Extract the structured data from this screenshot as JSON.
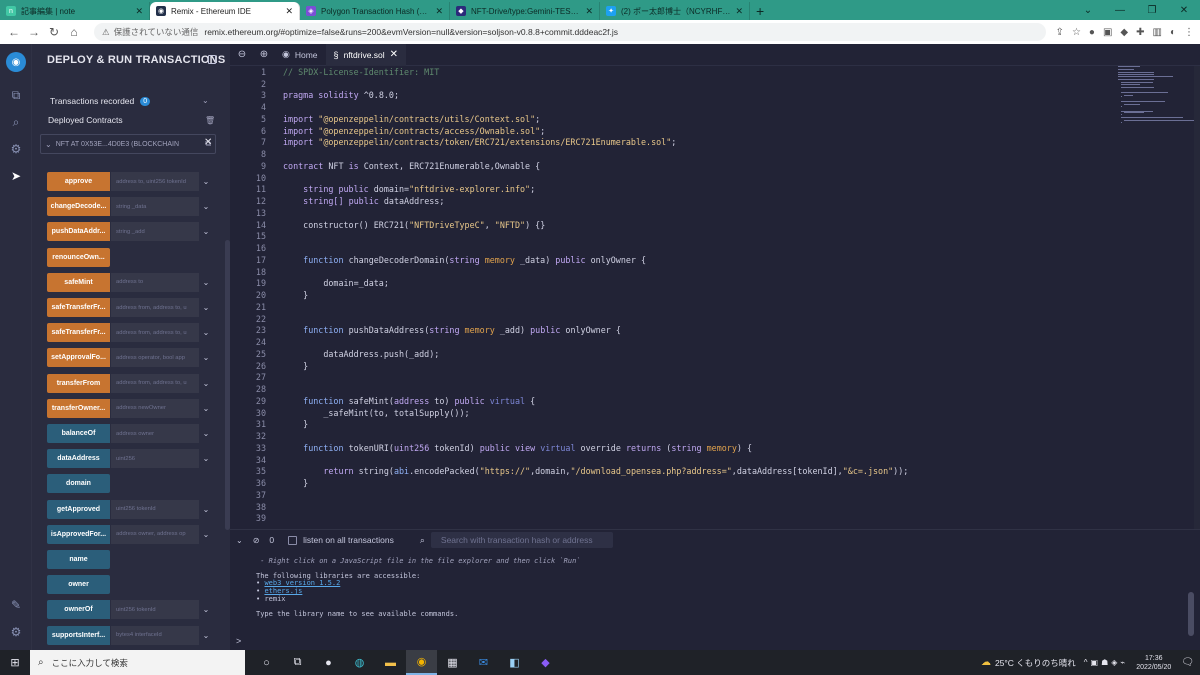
{
  "browser": {
    "tabs": [
      {
        "label": "記事編集 | note",
        "fav": "n",
        "color": "#42c8a5",
        "active": false
      },
      {
        "label": "Remix - Ethereum IDE",
        "fav": "◉",
        "color": "#23304a",
        "active": true
      },
      {
        "label": "Polygon Transaction Hash (Txhas",
        "fav": "◈",
        "color": "#7b4fd6",
        "active": false
      },
      {
        "label": "NFT-Drive/type:Gemini-TEST_NE",
        "fav": "◆",
        "color": "#2b2a7a",
        "active": false
      },
      {
        "label": "(2) ポー太郎博士（NCYRHFYAW7）",
        "fav": "✦",
        "color": "#1da1f2",
        "active": false
      }
    ],
    "new_tab": "+",
    "security_label": "保護されていない通信",
    "url": "remix.ethereum.org/#optimize=false&runs=200&evmVersion=null&version=soljson-v0.8.8+commit.dddeac2f.js"
  },
  "sidebar": {
    "title": "DEPLOY & RUN TRANSACTIONS",
    "tx_recorded_label": "Transactions recorded",
    "tx_recorded_count": "0",
    "deployed_label": "Deployed Contracts",
    "instance_label": "NFT AT 0X53E...4D0E3 (BLOCKCHAIN",
    "functions": [
      {
        "name": "approve",
        "params": "address to, uint256 tokenId",
        "color": "orange",
        "has_param": true
      },
      {
        "name": "changeDecode...",
        "params": "string _data",
        "color": "orange",
        "has_param": true
      },
      {
        "name": "pushDataAddr...",
        "params": "string _add",
        "color": "orange",
        "has_param": true
      },
      {
        "name": "renounceOwn...",
        "params": "",
        "color": "orange",
        "has_param": false
      },
      {
        "name": "safeMint",
        "params": "address to",
        "color": "orange",
        "has_param": true
      },
      {
        "name": "safeTransferFr...",
        "params": "address from, address to, u",
        "color": "orange",
        "has_param": true
      },
      {
        "name": "safeTransferFr...",
        "params": "address from, address to, u",
        "color": "orange",
        "has_param": true
      },
      {
        "name": "setApprovalFo...",
        "params": "address operator, bool app",
        "color": "orange",
        "has_param": true
      },
      {
        "name": "transferFrom",
        "params": "address from, address to, u",
        "color": "orange",
        "has_param": true
      },
      {
        "name": "transferOwner...",
        "params": "address newOwner",
        "color": "orange",
        "has_param": true
      },
      {
        "name": "balanceOf",
        "params": "address owner",
        "color": "blue",
        "has_param": true
      },
      {
        "name": "dataAddress",
        "params": "uint256",
        "color": "blue",
        "has_param": true
      },
      {
        "name": "domain",
        "params": "",
        "color": "blue",
        "has_param": false
      },
      {
        "name": "getApproved",
        "params": "uint256 tokenId",
        "color": "blue",
        "has_param": true
      },
      {
        "name": "isApprovedFor...",
        "params": "address owner, address op",
        "color": "blue",
        "has_param": true
      },
      {
        "name": "name",
        "params": "",
        "color": "blue",
        "has_param": false
      },
      {
        "name": "owner",
        "params": "",
        "color": "blue",
        "has_param": false
      },
      {
        "name": "ownerOf",
        "params": "uint256 tokenId",
        "color": "blue",
        "has_param": true
      },
      {
        "name": "supportsInterf...",
        "params": "bytes4 interfaceId",
        "color": "blue",
        "has_param": true
      }
    ]
  },
  "editor": {
    "tabs": [
      {
        "label": "Home",
        "icon": "◉",
        "active": false,
        "closable": false
      },
      {
        "label": "nftdrive.sol",
        "icon": "§",
        "active": true,
        "closable": true
      }
    ],
    "lines": [
      [
        [
          "// SPDX-License-Identifier: MIT",
          "#5f8a6e"
        ]
      ],
      [],
      [
        [
          "pragma ",
          "#c0a8f2"
        ],
        [
          "solidity ",
          "#c0a8f2"
        ],
        [
          "^0.8.0;",
          "#d0d1e3"
        ]
      ],
      [],
      [
        [
          "import ",
          "#c0a8f2"
        ],
        [
          "\"@openzeppelin/contracts/utils/Context.sol\"",
          "#e8c78a"
        ],
        [
          ";",
          "#d0d1e3"
        ]
      ],
      [
        [
          "import ",
          "#c0a8f2"
        ],
        [
          "\"@openzeppelin/contracts/access/Ownable.sol\"",
          "#e8c78a"
        ],
        [
          ";",
          "#d0d1e3"
        ]
      ],
      [
        [
          "import ",
          "#c0a8f2"
        ],
        [
          "\"@openzeppelin/contracts/token/ERC721/extensions/ERC721Enumerable.sol\"",
          "#e8c78a"
        ],
        [
          ";",
          "#d0d1e3"
        ]
      ],
      [],
      [
        [
          "contract ",
          "#c0a8f2"
        ],
        [
          "NFT ",
          "#d0d1e3"
        ],
        [
          "is ",
          "#c0a8f2"
        ],
        [
          "Context, ERC721Enumerable,Ownable {",
          "#d0d1e3"
        ]
      ],
      [],
      [
        [
          "    string ",
          "#c0a8f2"
        ],
        [
          "public ",
          "#c0a8f2"
        ],
        [
          "domain=",
          "#d0d1e3"
        ],
        [
          "\"nftdrive-explorer.info\"",
          "#e8c78a"
        ],
        [
          ";",
          "#d0d1e3"
        ]
      ],
      [
        [
          "    string[] ",
          "#c0a8f2"
        ],
        [
          "public ",
          "#c0a8f2"
        ],
        [
          "dataAddress;",
          "#d0d1e3"
        ]
      ],
      [],
      [
        [
          "    constructor() ",
          "#d0d1e3"
        ],
        [
          "ERC721(",
          "#d0d1e3"
        ],
        [
          "\"NFTDriveTypeC\"",
          "#e8c78a"
        ],
        [
          ", ",
          "#d0d1e3"
        ],
        [
          "\"NFTD\"",
          "#e8c78a"
        ],
        [
          ") {}",
          "#d0d1e3"
        ]
      ],
      [],
      [],
      [
        [
          "    function ",
          "#8fb0f5"
        ],
        [
          "changeDecoderDomain(",
          "#d0d1e3"
        ],
        [
          "string ",
          "#c0a8f2"
        ],
        [
          "memory ",
          "#e0a24d"
        ],
        [
          "_data) ",
          "#d0d1e3"
        ],
        [
          "public ",
          "#c0a8f2"
        ],
        [
          "onlyOwner {",
          "#d0d1e3"
        ]
      ],
      [],
      [
        [
          "        domain=_data;",
          "#d0d1e3"
        ]
      ],
      [
        [
          "    }",
          "#d0d1e3"
        ]
      ],
      [],
      [],
      [
        [
          "    function ",
          "#8fb0f5"
        ],
        [
          "pushDataAddress(",
          "#d0d1e3"
        ],
        [
          "string ",
          "#c0a8f2"
        ],
        [
          "memory ",
          "#e0a24d"
        ],
        [
          "_add) ",
          "#d0d1e3"
        ],
        [
          "public ",
          "#c0a8f2"
        ],
        [
          "onlyOwner {",
          "#d0d1e3"
        ]
      ],
      [],
      [
        [
          "        dataAddress.push(_add);",
          "#d0d1e3"
        ]
      ],
      [
        [
          "    }",
          "#d0d1e3"
        ]
      ],
      [],
      [],
      [
        [
          "    function ",
          "#8fb0f5"
        ],
        [
          "safeMint(",
          "#d0d1e3"
        ],
        [
          "address ",
          "#c0a8f2"
        ],
        [
          "to) ",
          "#d0d1e3"
        ],
        [
          "public ",
          "#c0a8f2"
        ],
        [
          "virtual ",
          "#7d86d6"
        ],
        [
          "{",
          "#d0d1e3"
        ]
      ],
      [
        [
          "        _safeMint(to, totalSupply());",
          "#d0d1e3"
        ]
      ],
      [
        [
          "    }",
          "#d0d1e3"
        ]
      ],
      [],
      [
        [
          "    function ",
          "#8fb0f5"
        ],
        [
          "tokenURI(",
          "#d0d1e3"
        ],
        [
          "uint256 ",
          "#c0a8f2"
        ],
        [
          "tokenId) ",
          "#d0d1e3"
        ],
        [
          "public ",
          "#c0a8f2"
        ],
        [
          "view ",
          "#c0a8f2"
        ],
        [
          "virtual ",
          "#7d86d6"
        ],
        [
          "override ",
          "#d0d1e3"
        ],
        [
          "returns ",
          "#c0a8f2"
        ],
        [
          "(",
          "#d0d1e3"
        ],
        [
          "string ",
          "#c0a8f2"
        ],
        [
          "memory",
          "#e0a24d"
        ],
        [
          ") {",
          "#d0d1e3"
        ]
      ],
      [],
      [
        [
          "        return ",
          "#c0a8f2"
        ],
        [
          "string(",
          "#d0d1e3"
        ],
        [
          "abi",
          "#8fb0f5"
        ],
        [
          ".encodePacked(",
          "#d0d1e3"
        ],
        [
          "\"https://\"",
          "#e8c78a"
        ],
        [
          ",domain,",
          "#d0d1e3"
        ],
        [
          "\"/download_opensea.php?address=\"",
          "#e8c78a"
        ],
        [
          ",dataAddress[tokenId],",
          "#d0d1e3"
        ],
        [
          "\"&c=.json\"",
          "#e8c78a"
        ],
        [
          "));",
          "#d0d1e3"
        ]
      ],
      [
        [
          "    }",
          "#d0d1e3"
        ]
      ],
      [],
      [],
      []
    ]
  },
  "terminal": {
    "count": "0",
    "listen_label": "listen on all transactions",
    "search_placeholder": "Search with transaction hash or address",
    "hint_line": " - Right click on a JavaScript file in the file explorer and then click `Run`",
    "libs_line": "The following libraries are accessible:",
    "libs": [
      "web3 version 1.5.2",
      "ethers.js",
      "remix"
    ],
    "type_line": "Type the library name to see available commands.",
    "prompt": ">"
  },
  "taskbar": {
    "search_placeholder": "ここに入力して検索",
    "weather": "25°C くもりのち晴れ",
    "time": "17:36",
    "date": "2022/05/20"
  }
}
